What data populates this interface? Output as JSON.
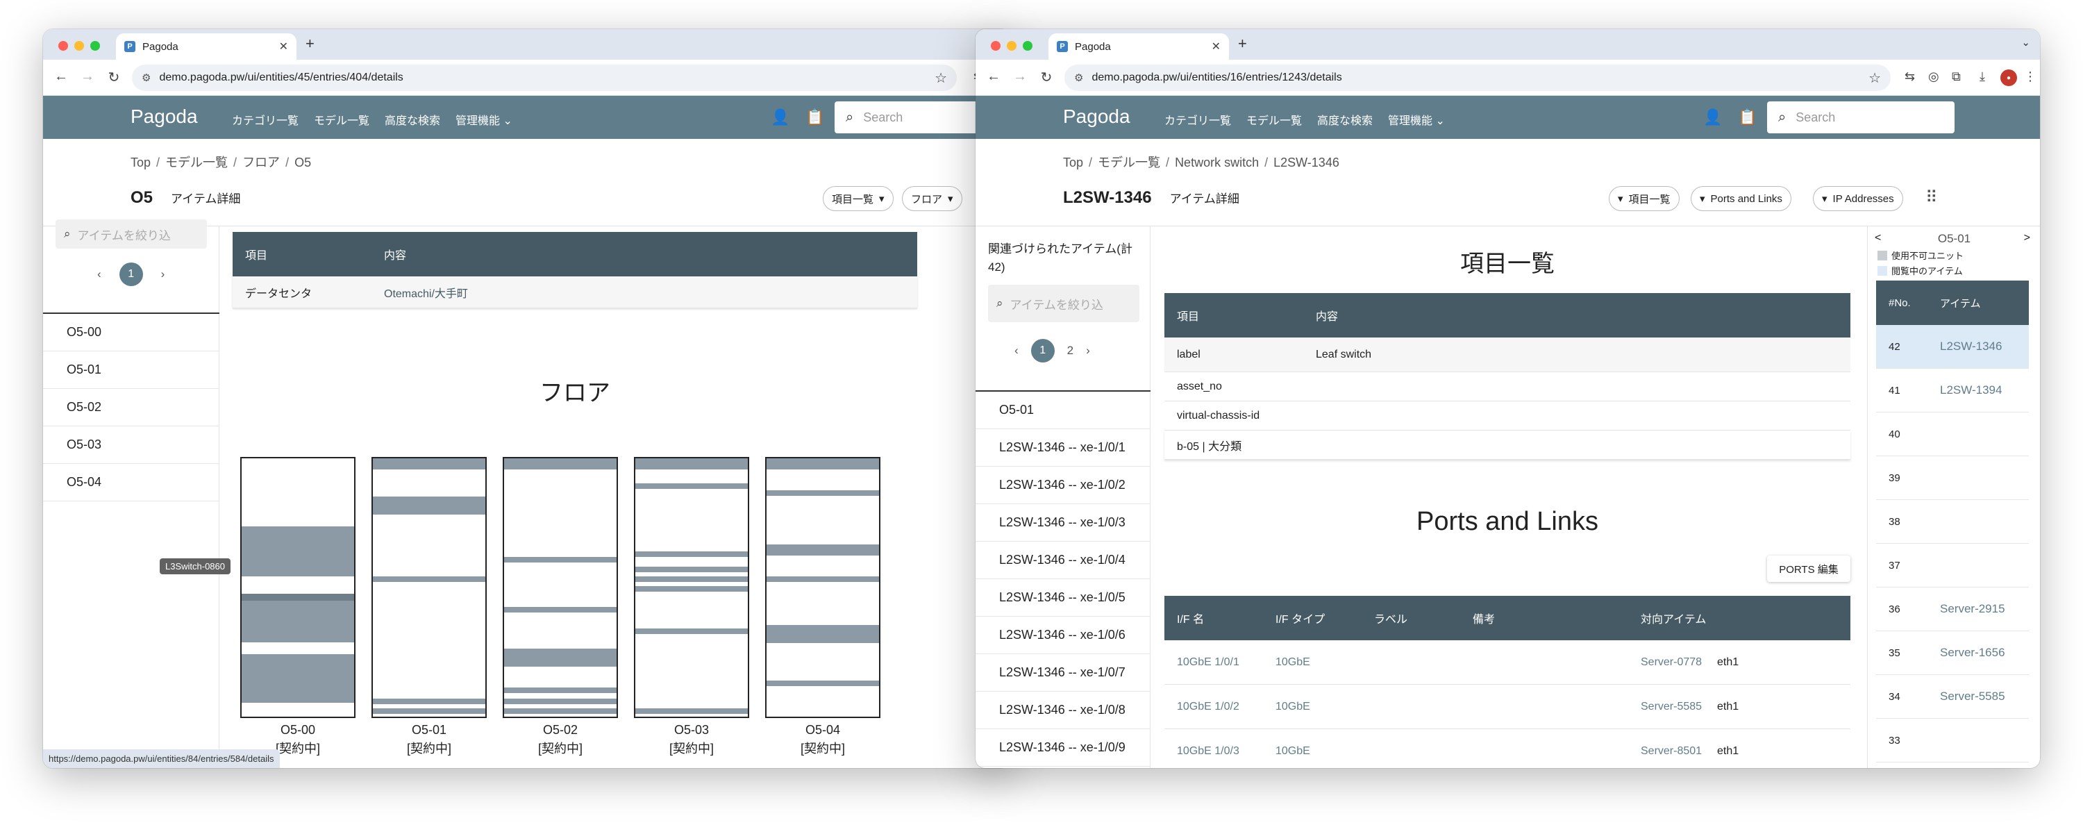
{
  "window1": {
    "tab_title": "Pagoda",
    "url": "demo.pagoda.pw/ui/entities/45/entries/404/details",
    "brand": "Pagoda",
    "menu": [
      "カテゴリ一覧",
      "モデル一覧",
      "高度な検索",
      "管理機能"
    ],
    "search_placeholder": "Search",
    "breadcrumb": [
      "Top",
      "モデル一覧",
      "フロア",
      "O5"
    ],
    "title": "O5",
    "subtitle": "アイテム詳細",
    "chips": [
      "項目一覧",
      "フロア"
    ],
    "filter_placeholder": "アイテムを絞り込",
    "page_current": "1",
    "side_items": [
      "O5-00",
      "O5-01",
      "O5-02",
      "O5-03",
      "O5-04"
    ],
    "table_headers": [
      "項目",
      "内容"
    ],
    "table_rows": [
      [
        "データセンタ",
        "Otemachi/大手町"
      ]
    ],
    "section_title": "フロア",
    "racks": [
      {
        "name": "O5-00",
        "status": "[契約中]"
      },
      {
        "name": "O5-01",
        "status": "[契約中]"
      },
      {
        "name": "O5-02",
        "status": "[契約中]"
      },
      {
        "name": "O5-03",
        "status": "[契約中]"
      },
      {
        "name": "O5-04",
        "status": "[契約中]"
      }
    ],
    "tooltip": "L3Switch-0860",
    "status_url": "https://demo.pagoda.pw/ui/entities/84/entries/584/details"
  },
  "window2": {
    "tab_title": "Pagoda",
    "url": "demo.pagoda.pw/ui/entities/16/entries/1243/details",
    "brand": "Pagoda",
    "menu": [
      "カテゴリ一覧",
      "モデル一覧",
      "高度な検索",
      "管理機能"
    ],
    "search_placeholder": "Search",
    "breadcrumb": [
      "Top",
      "モデル一覧",
      "Network switch",
      "L2SW-1346"
    ],
    "title": "L2SW-1346",
    "subtitle": "アイテム詳細",
    "chips": [
      "項目一覧",
      "Ports and Links",
      "IP Addresses"
    ],
    "related_title": "関連づけられたアイテム(計42)",
    "filter_placeholder": "アイテムを絞り込",
    "pages": [
      "1",
      "2"
    ],
    "related_items": [
      "O5-01",
      "L2SW-1346 -- xe-1/0/1",
      "L2SW-1346 -- xe-1/0/2",
      "L2SW-1346 -- xe-1/0/3",
      "L2SW-1346 -- xe-1/0/4",
      "L2SW-1346 -- xe-1/0/5",
      "L2SW-1346 -- xe-1/0/6",
      "L2SW-1346 -- xe-1/0/7",
      "L2SW-1346 -- xe-1/0/8",
      "L2SW-1346 -- xe-1/0/9"
    ],
    "attr_title": "項目一覧",
    "attr_headers": [
      "項目",
      "内容"
    ],
    "attr_rows": [
      [
        "label",
        "Leaf switch"
      ],
      [
        "asset_no",
        ""
      ],
      [
        "virtual-chassis-id",
        ""
      ],
      [
        "b-05 | 大分類",
        ""
      ]
    ],
    "ports_title": "Ports and Links",
    "ports_edit": "PORTS 編集",
    "ports_headers": [
      "I/F 名",
      "I/F タイプ",
      "ラベル",
      "備考",
      "対向アイテム"
    ],
    "ports_rows": [
      {
        "ifname": "10GbE 1/0/1",
        "iftype": "10GbE",
        "peer": "Server-0778",
        "peer_if": "eth1"
      },
      {
        "ifname": "10GbE 1/0/2",
        "iftype": "10GbE",
        "peer": "Server-5585",
        "peer_if": "eth1"
      },
      {
        "ifname": "10GbE 1/0/3",
        "iftype": "10GbE",
        "peer": "Server-8501",
        "peer_if": "eth1"
      }
    ],
    "rack_nav": {
      "prev": "<",
      "title": "O5-01",
      "next": ">"
    },
    "legend": [
      "使用不可ユニット",
      "閲覧中のアイテム"
    ],
    "rack_headers": [
      "#No.",
      "アイテム"
    ],
    "rack_rows": [
      {
        "no": "42",
        "item": "L2SW-1346"
      },
      {
        "no": "41",
        "item": "L2SW-1394"
      },
      {
        "no": "40",
        "item": ""
      },
      {
        "no": "39",
        "item": ""
      },
      {
        "no": "38",
        "item": ""
      },
      {
        "no": "37",
        "item": ""
      },
      {
        "no": "36",
        "item": "Server-2915"
      },
      {
        "no": "35",
        "item": "Server-1656"
      },
      {
        "no": "34",
        "item": "Server-5585"
      },
      {
        "no": "33",
        "item": ""
      }
    ]
  },
  "colors": {
    "appbar": "#607d8b",
    "table_header": "#455a64",
    "rack_fill": "#8b9aa4",
    "highlight": "#dce9f7"
  }
}
